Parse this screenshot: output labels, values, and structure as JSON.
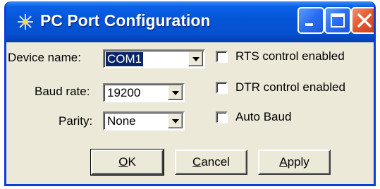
{
  "window": {
    "title": "PC Port Configuration",
    "title_icon": "sparkle-icon"
  },
  "caption_buttons": {
    "minimize": "minimize-icon",
    "maximize": "maximize-icon",
    "close": "close-icon"
  },
  "fields": {
    "device_name": {
      "label": "Device name:",
      "value": "COM1"
    },
    "baud_rate": {
      "label": "Baud rate:",
      "value": "19200"
    },
    "parity": {
      "label": "Parity:",
      "value": "None"
    }
  },
  "options": {
    "rts": {
      "label": "RTS control enabled",
      "checked": false
    },
    "dtr": {
      "label": "DTR control enabled",
      "checked": false
    },
    "auto_baud": {
      "label": "Auto Baud",
      "checked": false
    }
  },
  "buttons": {
    "ok": {
      "mnemonic": "O",
      "rest": "K"
    },
    "cancel": {
      "mnemonic": "C",
      "rest": "ancel"
    },
    "apply": {
      "mnemonic": "A",
      "rest": "pply"
    }
  },
  "colors": {
    "titlebar": "#0654d6",
    "dialog_bg": "#ece9d8",
    "selection": "#0a246a",
    "close_button": "#e0542c"
  }
}
